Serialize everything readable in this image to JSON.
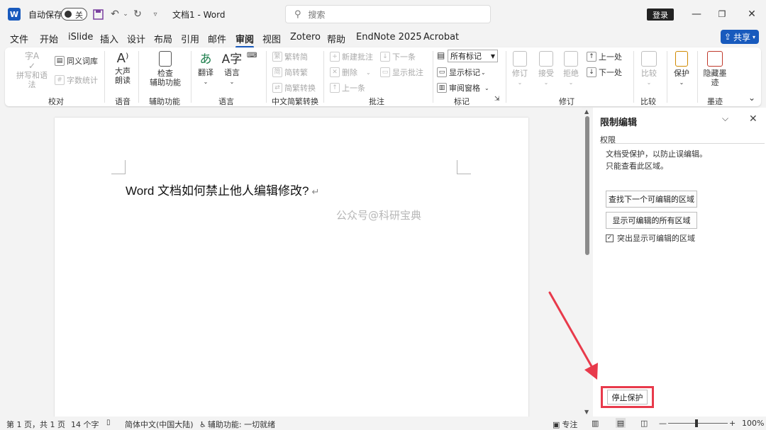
{
  "titlebar": {
    "app_logo": "W",
    "autosave_label": "自动保存",
    "autosave_state": "关",
    "doc_title": "文档1 - Word",
    "search_placeholder": "搜索",
    "login_label": "登录",
    "icons": [
      "save-icon",
      "undo-icon",
      "redo-icon",
      "qat-dropdown-icon",
      "minimize-icon",
      "restore-icon",
      "close-icon"
    ]
  },
  "tabs": [
    "文件",
    "开始",
    "iSlide",
    "插入",
    "设计",
    "布局",
    "引用",
    "邮件",
    "审阅",
    "视图",
    "Zotero",
    "帮助",
    "EndNote 2025",
    "Acrobat"
  ],
  "active_tab": "审阅",
  "share_label": "共享",
  "ribbon": {
    "proofing": {
      "spell": "拼写和语法",
      "thesaurus": "同义词库",
      "wordcount": "字数统计",
      "label": "校对"
    },
    "speech": {
      "read_aloud_1": "大声",
      "read_aloud_2": "朗读",
      "label": "语音"
    },
    "accessibility": {
      "check_1": "检查",
      "check_2": "辅助功能",
      "label": "辅助功能"
    },
    "language": {
      "translate": "翻译",
      "language": "语言",
      "label": "语言"
    },
    "chinese": {
      "t2s": "繁转简",
      "s2t": "简转繁",
      "convert": "简繁转换",
      "label": "中文简繁转换"
    },
    "comments": {
      "new": "新建批注",
      "delete": "删除",
      "prev": "上一条",
      "next": "下一条",
      "show": "显示批注",
      "label": "批注"
    },
    "tracking_markup": {
      "combo_value": "所有标记",
      "show_markup": "显示标记",
      "review_pane": "审阅窗格",
      "label": "标记"
    },
    "changes": {
      "track": "修订",
      "accept": "接受",
      "reject": "拒绝",
      "prev": "上一处",
      "next": "下一处",
      "label": "修订"
    },
    "compare": {
      "compare": "比较",
      "label": "比较"
    },
    "protect": {
      "protect": "保护",
      "label": ""
    },
    "ink": {
      "hide_ink_1": "隐藏墨",
      "hide_ink_2": "迹",
      "label": "墨迹"
    }
  },
  "document": {
    "body_text": "Word 文档如何禁止他人编辑修改?",
    "para_mark": "↵",
    "watermark": "公众号@科研宝典"
  },
  "pane": {
    "title": "限制编辑",
    "section": "权限",
    "desc_line1": "文档受保护，以防止误编辑。",
    "desc_line2": "只能查看此区域。",
    "find_next": "查找下一个可编辑的区域",
    "show_all": "显示可编辑的所有区域",
    "highlight_label": "突出显示可编辑的区域",
    "highlight_checked": true,
    "stop_protect": "停止保护"
  },
  "statusbar": {
    "page": "第 1 页，共 1 页",
    "words": "14 个字",
    "language": "简体中文(中国大陆)",
    "accessibility": "辅助功能: 一切就绪",
    "focus": "专注",
    "zoom": "100%"
  },
  "colors": {
    "accent": "#185abd",
    "highlight_border": "#e83a4b"
  }
}
